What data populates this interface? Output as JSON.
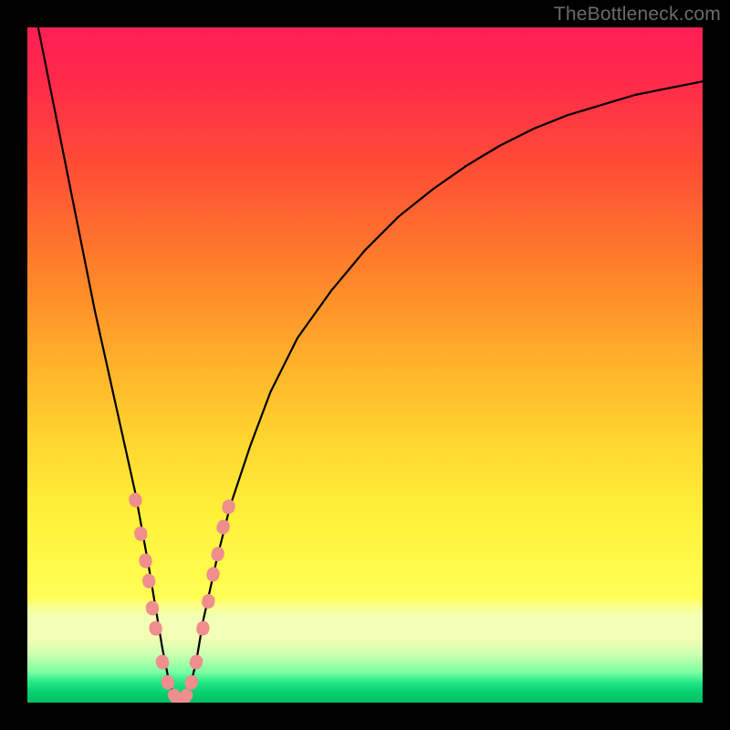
{
  "watermark": "TheBottleneck.com",
  "colors": {
    "gradient_stops": [
      {
        "offset": 0.0,
        "color": "#ff1f54"
      },
      {
        "offset": 0.08,
        "color": "#ff2a4a"
      },
      {
        "offset": 0.2,
        "color": "#ff4b36"
      },
      {
        "offset": 0.35,
        "color": "#ff7e2a"
      },
      {
        "offset": 0.5,
        "color": "#ffb22a"
      },
      {
        "offset": 0.62,
        "color": "#ffd82f"
      },
      {
        "offset": 0.73,
        "color": "#fff23a"
      },
      {
        "offset": 0.845,
        "color": "#ffff55"
      },
      {
        "offset": 0.855,
        "color": "#fbff86"
      },
      {
        "offset": 0.872,
        "color": "#f3ffb4"
      },
      {
        "offset": 0.905,
        "color": "#f3ffb4"
      },
      {
        "offset": 0.93,
        "color": "#c9ffb0"
      },
      {
        "offset": 0.955,
        "color": "#7affa2"
      },
      {
        "offset": 0.97,
        "color": "#22e884"
      },
      {
        "offset": 0.985,
        "color": "#08d06e"
      },
      {
        "offset": 1.0,
        "color": "#03bf63"
      }
    ],
    "curve": "#000000",
    "marker": "#f08d8d",
    "frame": "#000000"
  },
  "chart_data": {
    "type": "line",
    "title": "",
    "xlabel": "",
    "ylabel": "",
    "xlim": [
      0,
      100
    ],
    "ylim": [
      0,
      100
    ],
    "note": "y-axis shown inverted visually (0 at bottom = green, 100 at top = red)",
    "series": [
      {
        "name": "bottleneck-curve",
        "x": [
          0,
          2,
          4,
          6,
          8,
          10,
          12,
          14,
          16,
          18,
          19,
          20,
          21,
          22,
          23,
          24,
          25,
          26,
          28,
          30,
          33,
          36,
          40,
          45,
          50,
          55,
          60,
          65,
          70,
          75,
          80,
          85,
          90,
          95,
          100
        ],
        "y": [
          108,
          98,
          88,
          78,
          68,
          58,
          49,
          40,
          31,
          20,
          14,
          8,
          3,
          0,
          0,
          2,
          6,
          12,
          21,
          29,
          38,
          46,
          54,
          61,
          67,
          72,
          76,
          79.5,
          82.5,
          85,
          87,
          88.5,
          90,
          91,
          92
        ]
      }
    ],
    "markers": {
      "name": "highlighted-points",
      "points": [
        {
          "x": 16.0,
          "y": 30
        },
        {
          "x": 16.8,
          "y": 25
        },
        {
          "x": 17.5,
          "y": 21
        },
        {
          "x": 18.0,
          "y": 18
        },
        {
          "x": 18.5,
          "y": 14
        },
        {
          "x": 19.0,
          "y": 11
        },
        {
          "x": 20.0,
          "y": 6
        },
        {
          "x": 20.8,
          "y": 3
        },
        {
          "x": 21.8,
          "y": 1
        },
        {
          "x": 22.5,
          "y": 0
        },
        {
          "x": 23.5,
          "y": 1
        },
        {
          "x": 24.3,
          "y": 3
        },
        {
          "x": 25.0,
          "y": 6
        },
        {
          "x": 26.0,
          "y": 11
        },
        {
          "x": 26.8,
          "y": 15
        },
        {
          "x": 27.5,
          "y": 19
        },
        {
          "x": 28.2,
          "y": 22
        },
        {
          "x": 29.0,
          "y": 26
        },
        {
          "x": 29.8,
          "y": 29
        }
      ]
    }
  }
}
